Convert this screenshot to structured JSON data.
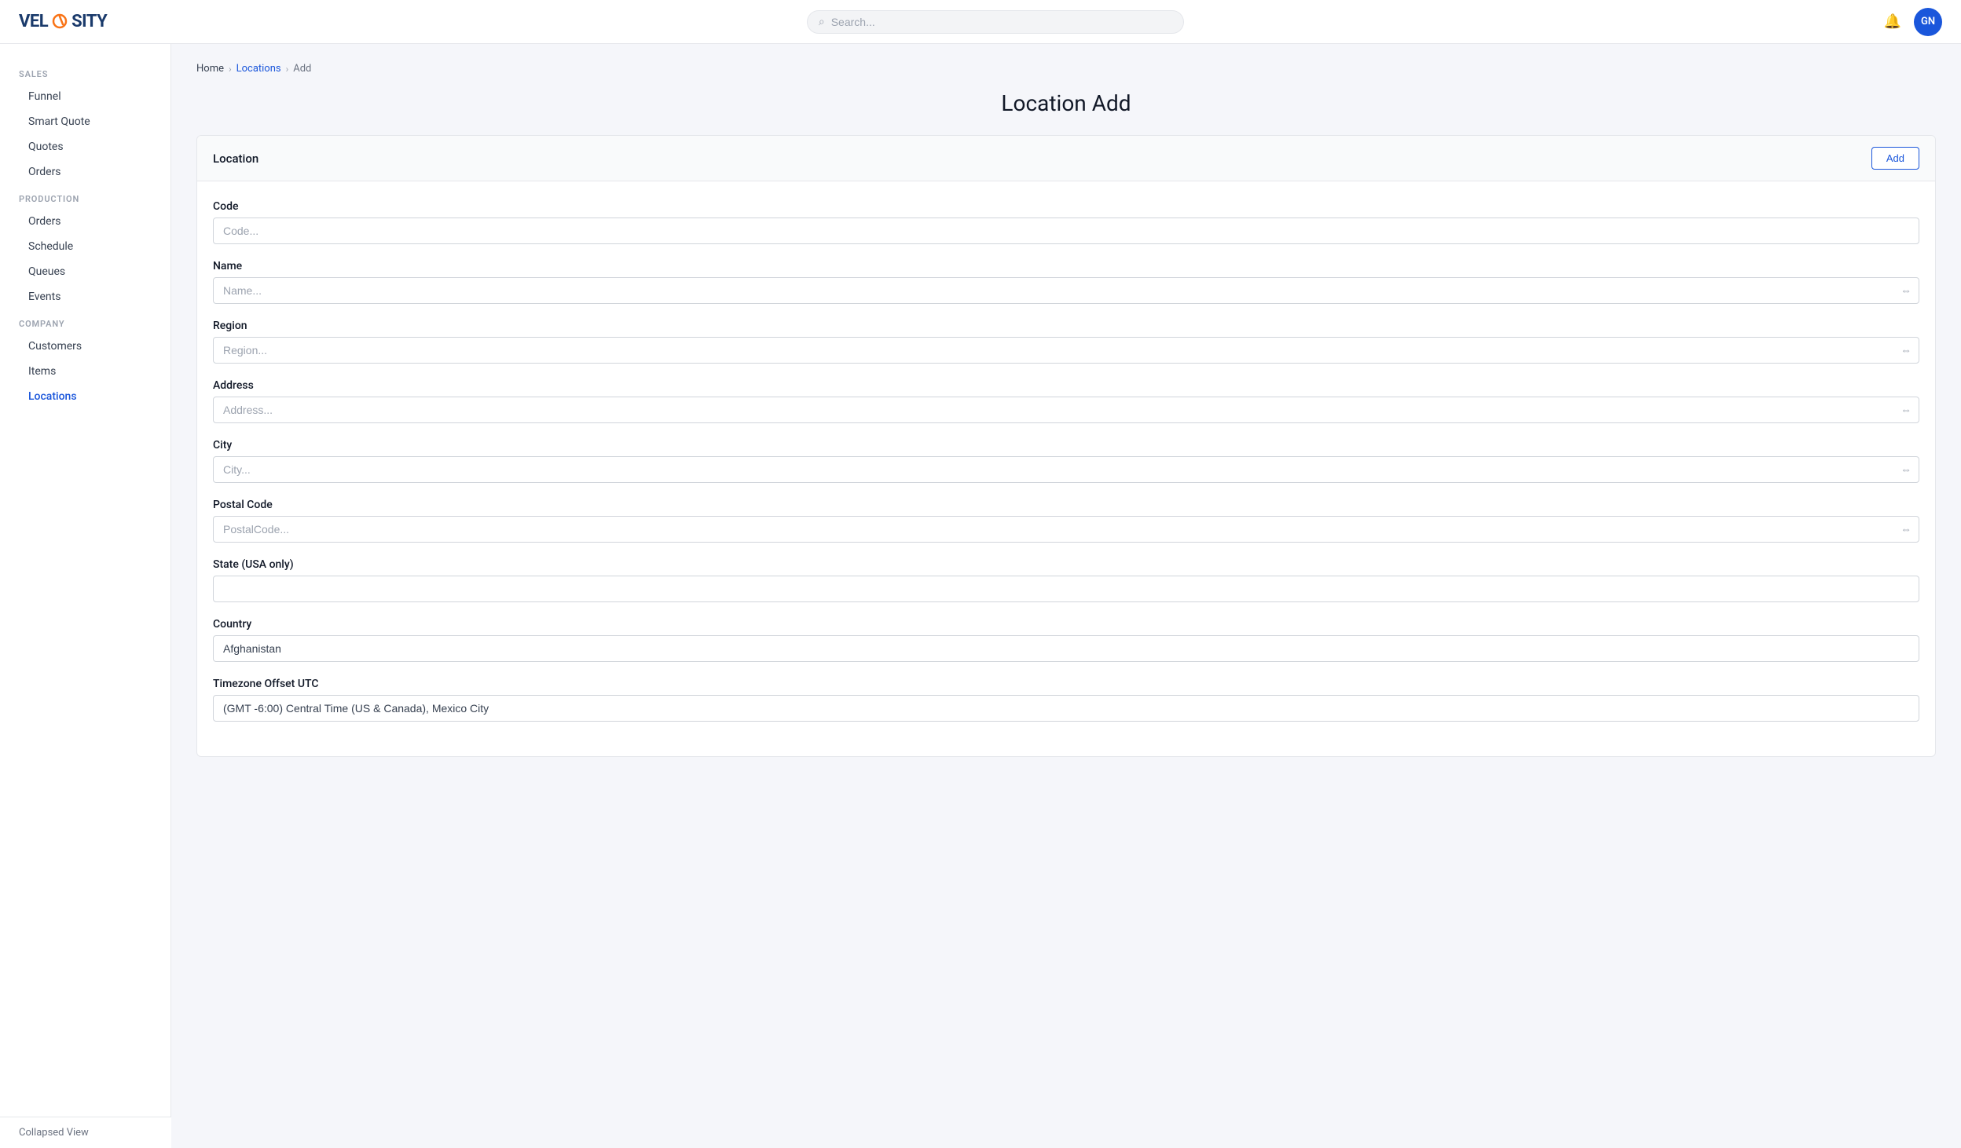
{
  "app": {
    "logo": "VEL",
    "logo_o": "O",
    "logo_full": "VELOSITY"
  },
  "navbar": {
    "search_placeholder": "Search...",
    "avatar_initials": "GN"
  },
  "sidebar": {
    "sections": [
      {
        "label": "SALES",
        "items": [
          {
            "id": "funnel",
            "label": "Funnel",
            "active": false
          },
          {
            "id": "smart-quote",
            "label": "Smart Quote",
            "active": false
          },
          {
            "id": "quotes",
            "label": "Quotes",
            "active": false
          },
          {
            "id": "sales-orders",
            "label": "Orders",
            "active": false
          }
        ]
      },
      {
        "label": "PRODUCTION",
        "items": [
          {
            "id": "production-orders",
            "label": "Orders",
            "active": false
          },
          {
            "id": "schedule",
            "label": "Schedule",
            "active": false
          },
          {
            "id": "queues",
            "label": "Queues",
            "active": false
          },
          {
            "id": "events",
            "label": "Events",
            "active": false
          }
        ]
      },
      {
        "label": "COMPANY",
        "items": [
          {
            "id": "customers",
            "label": "Customers",
            "active": false
          },
          {
            "id": "items",
            "label": "Items",
            "active": false
          },
          {
            "id": "locations",
            "label": "Locations",
            "active": true
          }
        ]
      }
    ],
    "collapsed_label": "Collapsed View"
  },
  "breadcrumb": {
    "home": "Home",
    "locations": "Locations",
    "current": "Add"
  },
  "page": {
    "title": "Location Add"
  },
  "card": {
    "section_title": "Location",
    "add_button": "Add"
  },
  "form": {
    "code_label": "Code",
    "code_placeholder": "Code...",
    "name_label": "Name",
    "name_placeholder": "Name...",
    "region_label": "Region",
    "region_placeholder": "Region...",
    "address_label": "Address",
    "address_placeholder": "Address...",
    "city_label": "City",
    "city_placeholder": "City...",
    "postal_code_label": "Postal Code",
    "postal_code_placeholder": "PostalCode...",
    "state_label": "State (USA only)",
    "state_value": "",
    "country_label": "Country",
    "country_value": "Afghanistan",
    "timezone_label": "Timezone Offset UTC",
    "timezone_value": "(GMT -6:00) Central Time (US & Canada), Mexico City"
  }
}
